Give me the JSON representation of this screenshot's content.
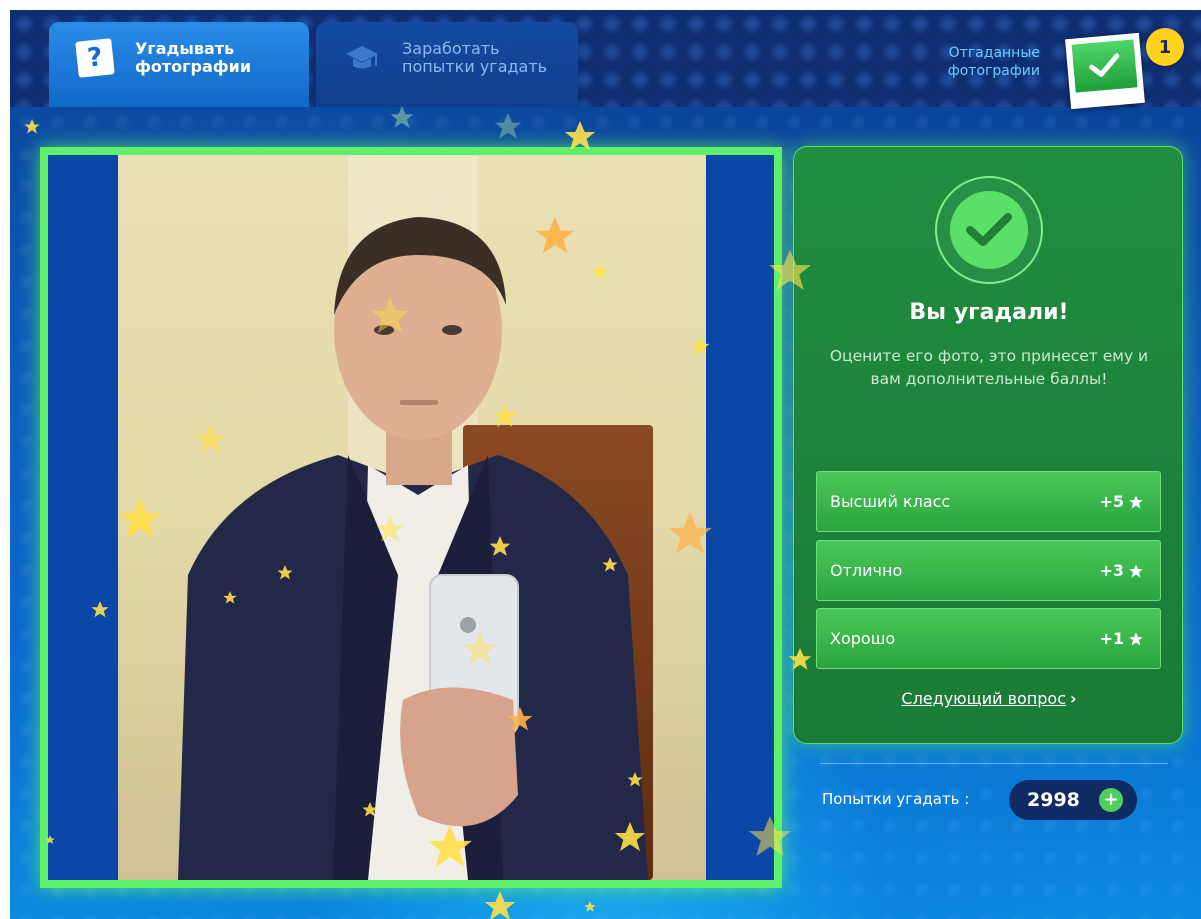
{
  "tabs": [
    {
      "label_line1": "Угадывать",
      "label_line2": "фотографии",
      "icon": "question-photo-icon",
      "active": true
    },
    {
      "label_line1": "Заработать",
      "label_line2": "попытки угадать",
      "icon": "graduation-cap-icon",
      "active": false
    }
  ],
  "guessed": {
    "label_line1": "Отгаданные",
    "label_line2": "фотографии",
    "count": "1"
  },
  "result": {
    "title": "Вы угадали!",
    "text": "Оцените его фото, это принесет ему и вам дополнительные баллы!",
    "ratings": [
      {
        "label": "Высший класс",
        "points": "+5"
      },
      {
        "label": "Отлично",
        "points": "+3"
      },
      {
        "label": "Хорошо",
        "points": "+1"
      }
    ],
    "next_label": "Следующий вопрос"
  },
  "attempts": {
    "label": "Попытки угадать :",
    "value": "2998"
  },
  "colors": {
    "accent_green": "#5ef06a",
    "panel_green": "#1f8e3f",
    "header_bg": "#0f2e72",
    "badge_yellow": "#ffd21f"
  }
}
